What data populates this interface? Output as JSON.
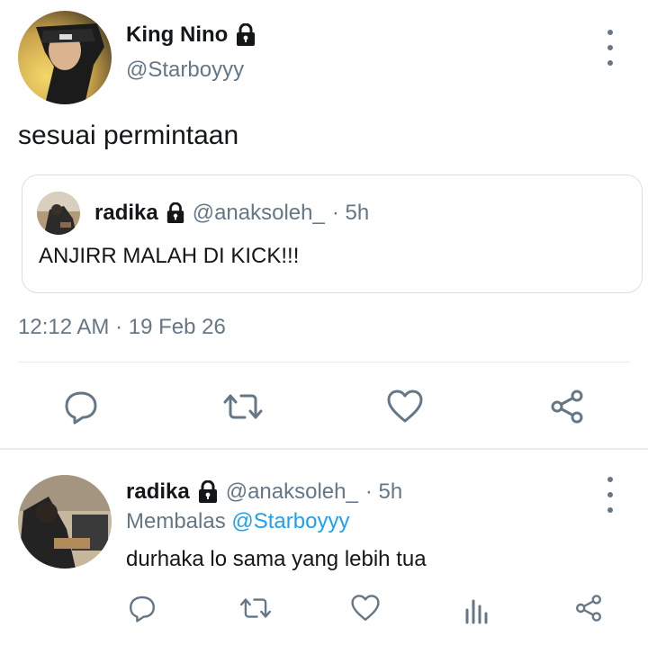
{
  "tweet": {
    "author_name": "King Nino",
    "author_handle": "@Starboyyy",
    "text": "sesuai permintaan",
    "timestamp": "12:12 AM · 19 Feb 26",
    "quoted": {
      "author_name": "radika",
      "author_handle": "@anaksoleh_",
      "time": "· 5h",
      "text": "ANJIRR MALAH DI KICK!!!"
    },
    "actions": [
      "reply-icon",
      "retweet-icon",
      "like-icon",
      "share-icon"
    ]
  },
  "reply": {
    "author_name": "radika",
    "author_handle": "@anaksoleh_",
    "time": "· 5h",
    "replying_prefix": "Membalas",
    "replying_to": "@Starboyyy",
    "text": "durhaka lo sama yang lebih tua",
    "actions": [
      "reply-icon",
      "retweet-icon",
      "like-icon",
      "analytics-icon",
      "share-icon"
    ]
  },
  "colors": {
    "text": "#14171a",
    "muted": "#657786",
    "link": "#1da1f2",
    "border": "#e6ecf0",
    "icon": "#657786"
  }
}
